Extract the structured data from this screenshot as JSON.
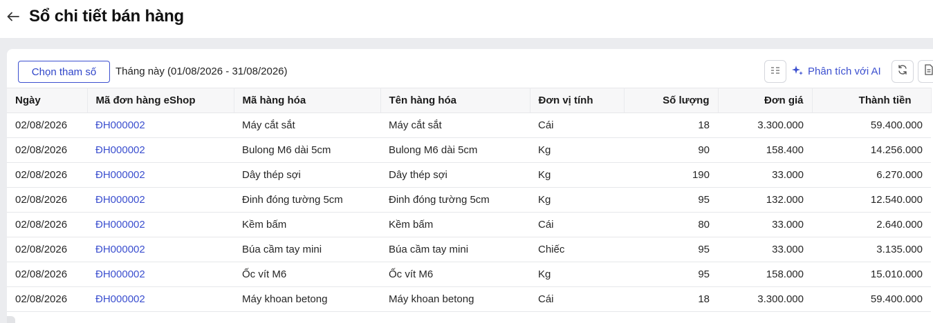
{
  "header": {
    "title": "Sổ chi tiết bán hàng"
  },
  "toolbar": {
    "params_button": "Chọn tham số",
    "period": "Tháng này (01/08/2026 - 31/08/2026)",
    "ai_button": "Phân tích với AI"
  },
  "table": {
    "columns": [
      "Ngày",
      "Mã đơn hàng eShop",
      "Mã hàng hóa",
      "Tên hàng hóa",
      "Đơn vị tính",
      "Số lượng",
      "Đơn giá",
      "Thành tiền"
    ],
    "rows": [
      [
        "02/08/2026",
        "ĐH000002",
        "Máy cắt sắt",
        "Máy cắt sắt",
        "Cái",
        "18",
        "3.300.000",
        "59.400.000"
      ],
      [
        "02/08/2026",
        "ĐH000002",
        "Bulong M6 dài 5cm",
        "Bulong M6 dài 5cm",
        "Kg",
        "90",
        "158.400",
        "14.256.000"
      ],
      [
        "02/08/2026",
        "ĐH000002",
        "Dây thép sợi",
        "Dây thép sợi",
        "Kg",
        "190",
        "33.000",
        "6.270.000"
      ],
      [
        "02/08/2026",
        "ĐH000002",
        "Đinh đóng tường 5cm",
        "Đinh đóng tường 5cm",
        "Kg",
        "95",
        "132.000",
        "12.540.000"
      ],
      [
        "02/08/2026",
        "ĐH000002",
        "Kềm bấm",
        "Kềm bấm",
        "Cái",
        "80",
        "33.000",
        "2.640.000"
      ],
      [
        "02/08/2026",
        "ĐH000002",
        "Búa cầm tay mini",
        "Búa cầm tay mini",
        "Chiếc",
        "95",
        "33.000",
        "3.135.000"
      ],
      [
        "02/08/2026",
        "ĐH000002",
        "Ốc vít M6",
        "Ốc vít M6",
        "Kg",
        "95",
        "158.000",
        "15.010.000"
      ],
      [
        "02/08/2026",
        "ĐH000002",
        "Máy khoan betong",
        "Máy khoan betong",
        "Cái",
        "18",
        "3.300.000",
        "59.400.000"
      ]
    ]
  },
  "icons": {
    "back": "arrow-left-icon",
    "columns": "column-settings-icon",
    "ai": "sparkle-icon",
    "refresh": "refresh-icon",
    "export": "document-icon"
  },
  "colors": {
    "accent": "#3b4fcf",
    "page_bg": "#ebecef",
    "header_bg": "#f7f7f8"
  }
}
